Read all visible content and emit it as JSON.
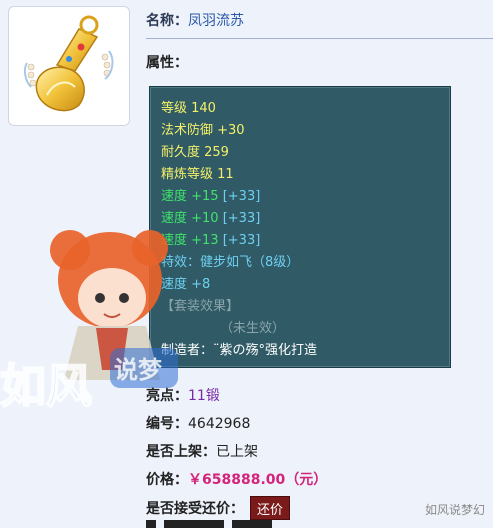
{
  "item": {
    "name_label": "名称：",
    "name": "凤羽流苏",
    "attr_label": "属性："
  },
  "stats": {
    "level": "等级 140",
    "magic_defense": "法术防御 +30",
    "durability": "耐久度 259",
    "refine": "精炼等级 11",
    "speed1_base": "速度 +15",
    "speed1_bonus": "[+33]",
    "speed2_base": "速度 +10",
    "speed2_bonus": "[+33]",
    "speed3_base": "速度 +13",
    "speed3_bonus": "[+33]",
    "effect": "特效：健步如飞（8级）",
    "speed4": "速度 +8",
    "set_effect": "【套装效果】",
    "set_status": "（未生效）",
    "maker": "制造者：¨紫の殇°强化打造"
  },
  "info": {
    "highlight_label": "亮点：",
    "highlight_value": "11锻",
    "id_label": "编号：",
    "id_value": "4642968",
    "listed_label": "是否上架：",
    "listed_value": "已上架",
    "price_label": "价格：",
    "price_value": "￥658888.00（元）",
    "bargain_label": "是否接受还价：",
    "bargain_button": "还价"
  },
  "watermark": {
    "mascot_text": "如风说梦幻",
    "corner_text": "如风说梦幻"
  },
  "colors": {
    "panel_bg": "#2f5a66",
    "stat_yellow": "#f4f06a",
    "stat_green": "#41e36b",
    "stat_cyan": "#6fd0f0",
    "price": "#d4237a",
    "bargain_button_bg": "#7a1a1a"
  },
  "icons": {
    "item_image": "golden-feather-tassel-ornament",
    "mascot": "red-haired-chibi-girl-mascot"
  }
}
